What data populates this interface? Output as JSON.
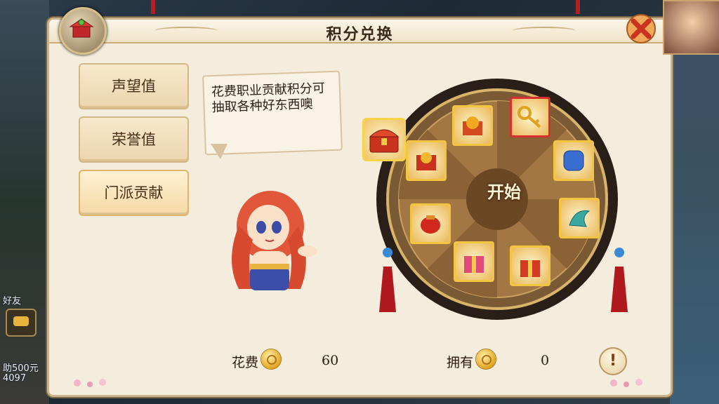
{
  "panel": {
    "title": "积分兑换"
  },
  "tabs": [
    {
      "label": "声望值",
      "active": false
    },
    {
      "label": "荣誉值",
      "active": false
    },
    {
      "label": "门派贡献",
      "active": true
    }
  ],
  "bubble": {
    "text": "花费职业贡献积分可抽取各种好东西噢"
  },
  "wheel": {
    "start_label": "开始",
    "items": [
      {
        "icon": "treasure-chest-icon",
        "selected": false
      },
      {
        "icon": "golden-orb-box-icon",
        "selected": false
      },
      {
        "icon": "golden-key-icon",
        "selected": true
      },
      {
        "icon": "blue-gem-icon",
        "selected": false
      },
      {
        "icon": "jade-dragon-icon",
        "selected": false
      },
      {
        "icon": "red-gift-box-icon",
        "selected": false
      },
      {
        "icon": "pink-gift-box-icon",
        "selected": false
      },
      {
        "icon": "red-pouch-icon",
        "selected": false
      }
    ]
  },
  "bottom": {
    "cost_label": "花费",
    "cost_value": "60",
    "own_label": "拥有",
    "own_value": "0",
    "info_label": "!"
  },
  "background": {
    "friends_label": "好友",
    "side_texts": [
      "助500元",
      "4097"
    ]
  },
  "colors": {
    "panel_bg": "#f4ecdc",
    "tab_bg": "#ecd5ae",
    "item_border": "#f2c640",
    "selected_border": "#d62f2f"
  }
}
